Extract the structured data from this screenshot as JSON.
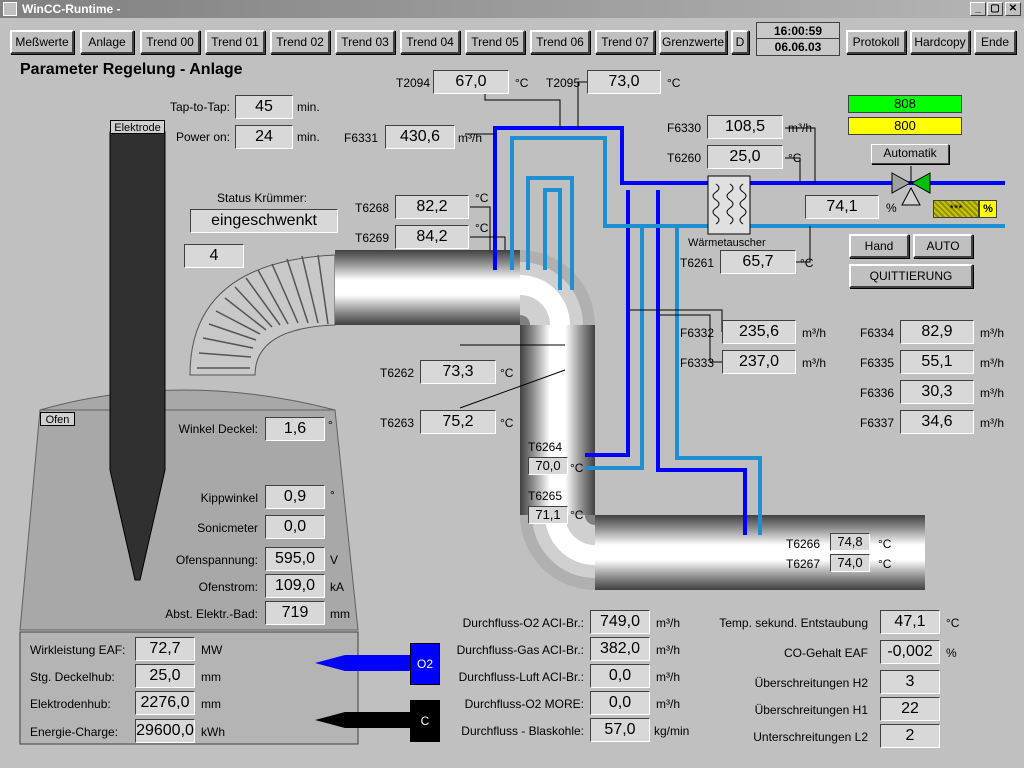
{
  "window": {
    "title": "WinCC-Runtime -",
    "min": "_",
    "max": "▢",
    "close": "✕"
  },
  "nav": [
    "Meßwerte",
    "Anlage",
    "Trend 00",
    "Trend 01",
    "Trend 02",
    "Trend 03",
    "Trend 04",
    "Trend 05",
    "Trend 06",
    "Trend 07",
    "Grenzwerte",
    "D"
  ],
  "clock": {
    "time": "16:00:59",
    "date": "06.06.03"
  },
  "right_nav": [
    "Protokoll",
    "Hardcopy",
    "Ende"
  ],
  "page_title": "Parameter Regelung - Anlage",
  "tap": {
    "label": "Tap-to-Tap:",
    "value": "45",
    "unit": "min."
  },
  "power_on": {
    "label": "Power on:",
    "value": "24",
    "unit": "min."
  },
  "electrode_label": "Elektrode",
  "status": {
    "label": "Status Krümmer:",
    "value": "eingeschwenkt",
    "num": "4"
  },
  "ofen_label": "Ofen",
  "temps": [
    {
      "label": "T2094",
      "value": "67,0",
      "unit": "°C"
    },
    {
      "label": "T2095",
      "value": "73,0",
      "unit": "°C"
    },
    {
      "label": "T6268",
      "value": "82,2",
      "unit": "°C"
    },
    {
      "label": "T6269",
      "value": "84,2",
      "unit": "°C"
    },
    {
      "label": "T6262",
      "value": "73,3",
      "unit": "°C"
    },
    {
      "label": "T6263",
      "value": "75,2",
      "unit": "°C"
    },
    {
      "label": "T6264",
      "value": "70,0",
      "unit": "°C"
    },
    {
      "label": "T6265",
      "value": "71,1",
      "unit": "°C"
    },
    {
      "label": "T6266",
      "value": "74,8",
      "unit": "°C"
    },
    {
      "label": "T6267",
      "value": "74,0",
      "unit": "°C"
    },
    {
      "label": "T6260",
      "value": "25,0",
      "unit": "°C"
    },
    {
      "label": "T6261",
      "value": "65,7",
      "unit": "°C"
    }
  ],
  "flows": [
    {
      "label": "F6331",
      "value": "430,6",
      "unit": "m³/h"
    },
    {
      "label": "F6330",
      "value": "108,5",
      "unit": "m³/h"
    },
    {
      "label": "F6332",
      "value": "235,6",
      "unit": "m³/h"
    },
    {
      "label": "F6333",
      "value": "237,0",
      "unit": "m³/h"
    },
    {
      "label": "F6334",
      "value": "82,9",
      "unit": "m³/h"
    },
    {
      "label": "F6335",
      "value": "55,1",
      "unit": "m³/h"
    },
    {
      "label": "F6336",
      "value": "30,3",
      "unit": "m³/h"
    },
    {
      "label": "F6337",
      "value": "34,6",
      "unit": "m³/h"
    }
  ],
  "heat_exchanger": "Wärmetauscher",
  "valve": {
    "value": "74,1",
    "unit": "%",
    "mode": "Automatik",
    "green": "808",
    "yellow": "800",
    "stars": "***",
    "pct": "%"
  },
  "buttons": {
    "hand": "Hand",
    "auto": "AUTO",
    "quit": "QUITTIERUNG"
  },
  "ofen_params": [
    {
      "label": "Winkel Deckel:",
      "value": "1,6",
      "unit": "°"
    },
    {
      "label": "Kippwinkel",
      "value": "0,9",
      "unit": "°"
    },
    {
      "label": "Sonicmeter",
      "value": "0,0",
      "unit": ""
    },
    {
      "label": "Ofenspannung:",
      "value": "595,0",
      "unit": "V"
    },
    {
      "label": "Ofenstrom:",
      "value": "109,0",
      "unit": "kA"
    },
    {
      "label": "Abst. Elektr.-Bad:",
      "value": "719",
      "unit": "mm"
    }
  ],
  "eaf": [
    {
      "label": "Wirkleistung EAF:",
      "value": "72,7",
      "unit": "MW"
    },
    {
      "label": "Stg. Deckelhub:",
      "value": "25,0",
      "unit": "mm"
    },
    {
      "label": "Elektrodenhub:",
      "value": "2276,0",
      "unit": "mm"
    },
    {
      "label": "Energie-Charge:",
      "value": "29600,0",
      "unit": "kWh"
    }
  ],
  "o2_tag": "O2",
  "c_tag": "C",
  "durchfluss": [
    {
      "label": "Durchfluss-O2 ACI-Br.:",
      "value": "749,0",
      "unit": "m³/h"
    },
    {
      "label": "Durchfluss-Gas ACI-Br.:",
      "value": "382,0",
      "unit": "m³/h"
    },
    {
      "label": "Durchfluss-Luft ACI-Br.:",
      "value": "0,0",
      "unit": "m³/h"
    },
    {
      "label": "Durchfluss-O2 MORE:",
      "value": "0,0",
      "unit": "m³/h"
    },
    {
      "label": "Durchfluss - Blaskohle:",
      "value": "57,0",
      "unit": "kg/min"
    }
  ],
  "right_params": [
    {
      "label": "Temp. sekund. Entstaubung",
      "value": "47,1",
      "unit": "°C"
    },
    {
      "label": "CO-Gehalt EAF",
      "value": "-0,002",
      "unit": "%"
    },
    {
      "label": "Überschreitungen H2",
      "value": "3",
      "unit": ""
    },
    {
      "label": "Überschreitungen H1",
      "value": "22",
      "unit": ""
    },
    {
      "label": "Unterschreitungen L2",
      "value": "2",
      "unit": ""
    }
  ],
  "colors": {
    "pipe_dark": "#0000ff",
    "pipe_light": "#1e8fd0",
    "green": "#00ff00",
    "yellow": "#ffff00"
  }
}
